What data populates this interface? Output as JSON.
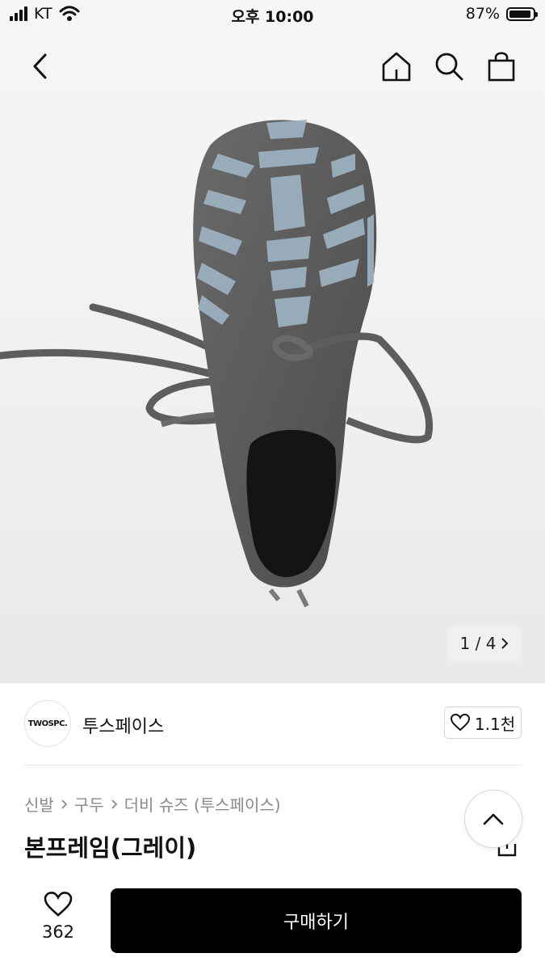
{
  "status_bar": {
    "carrier": "KT",
    "time": "오후 10:00",
    "battery_percent": "87%",
    "battery_level": 0.87
  },
  "nav": {
    "icons": [
      "back-icon",
      "home-icon",
      "search-icon",
      "bag-icon"
    ]
  },
  "gallery": {
    "counter": "1 / 4",
    "current_index": 1,
    "total": 4
  },
  "brand": {
    "logo_text": "TWOSPC.",
    "name": "투스페이스",
    "like_count": "1.1천"
  },
  "breadcrumb": [
    "신발",
    "구두",
    "더비 슈즈 (투스페이스)"
  ],
  "product": {
    "title": "본프레임(그레이)"
  },
  "bottom_bar": {
    "wish_count": "362",
    "buy_label": "구매하기"
  },
  "colors": {
    "buy_button": "#000000",
    "shoe_body": "#5f5f5f",
    "shoe_bones": "#9fb4c4"
  }
}
